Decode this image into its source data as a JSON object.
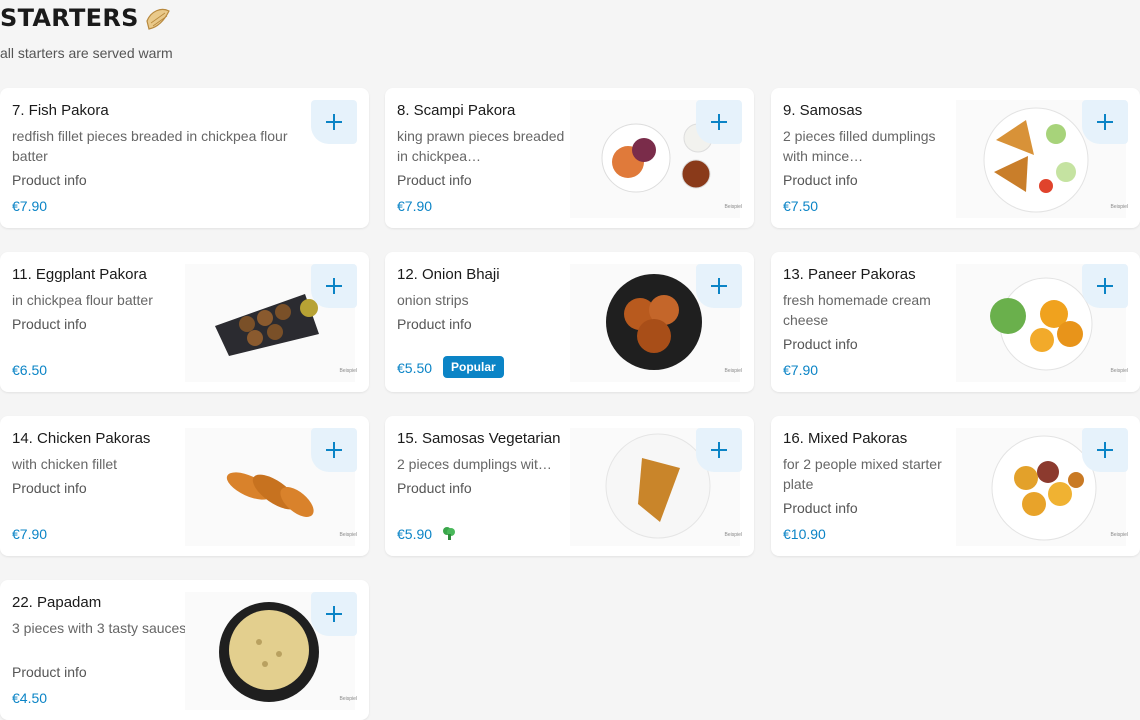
{
  "section": {
    "title": "STARTERS",
    "subtitle": "all starters are served warm"
  },
  "colors": {
    "accent": "#0b84c6",
    "add_bg": "#e6f2fb"
  },
  "items": [
    {
      "name": "7. Fish Pakora",
      "desc": "redfish fillet pieces breaded in chickpea flour batter",
      "info": "Product info",
      "price": "€7.90"
    },
    {
      "name": "8. Scampi Pakora",
      "desc": "king prawn pieces breaded in chickpea…",
      "info": "Product info",
      "price": "€7.90",
      "sample": "Beispiel"
    },
    {
      "name": "9. Samosas",
      "desc": "2 pieces filled dumplings with mince…",
      "info": "Product info",
      "price": "€7.50",
      "sample": "Beispiel"
    },
    {
      "name": "11. Eggplant Pakora",
      "desc": "in chickpea flour batter",
      "info": "Product info",
      "price": "€6.50",
      "sample": "Beispiel"
    },
    {
      "name": "12. Onion Bhaji",
      "desc": "onion strips",
      "info": "Product info",
      "price": "€5.50",
      "badge": "Popular",
      "sample": "Beispiel"
    },
    {
      "name": "13. Paneer Pakoras",
      "desc": "fresh homemade cream cheese",
      "info": "Product info",
      "price": "€7.90",
      "sample": "Beispiel"
    },
    {
      "name": "14. Chicken Pakoras",
      "desc": "with chicken fillet",
      "info": "Product info",
      "price": "€7.90",
      "sample": "Beispiel"
    },
    {
      "name": "15. Samosas Vegetarian",
      "desc": "2 pieces dumplings wit…",
      "info": "Product info",
      "price": "€5.90",
      "icon": "vegetarian-broccoli-icon",
      "sample": "Beispiel"
    },
    {
      "name": "16. Mixed Pakoras",
      "desc": "for 2 people mixed starter plate",
      "info": "Product info",
      "price": "€10.90",
      "sample": "Beispiel"
    },
    {
      "name": "22. Papadam",
      "desc": "3 pieces with 3 tasty sauces",
      "info": "Product info",
      "price": "€4.50",
      "sample": "Beispiel"
    }
  ]
}
